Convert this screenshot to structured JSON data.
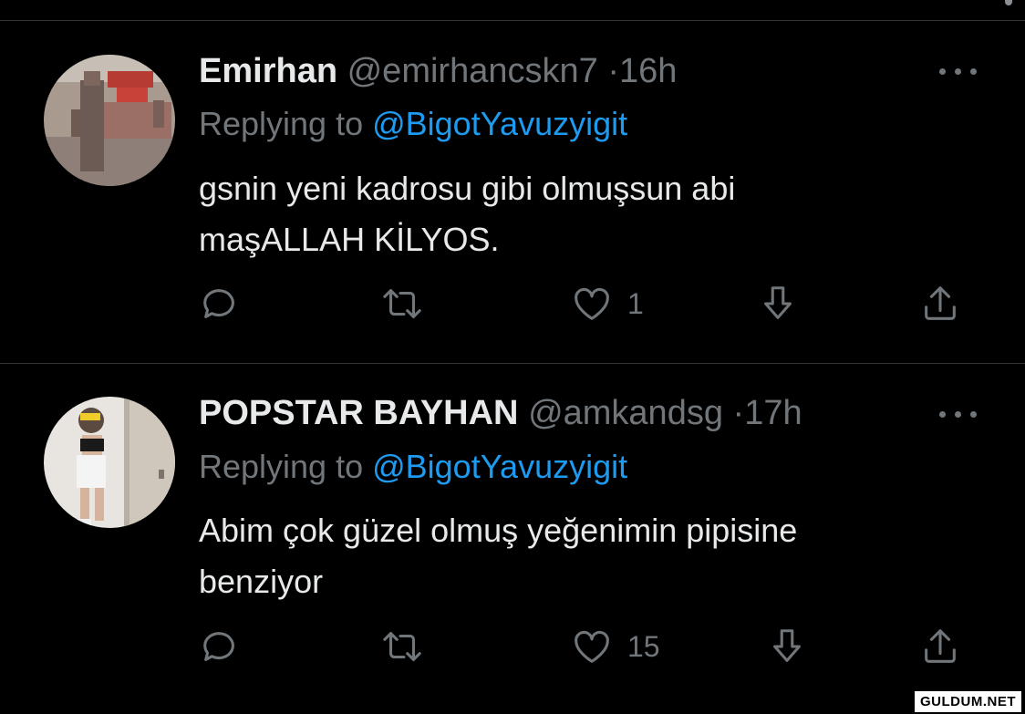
{
  "tweets": [
    {
      "name": "Emirhan",
      "handle": "@emirhancskn7",
      "separator": "·",
      "time": "16h",
      "replying_prefix": "Replying to ",
      "replying_to": "@BigotYavuzyigit",
      "text": "gsnin yeni kadrosu gibi olmuşsun abi\nmaşALLAH KİLYOS.",
      "likes": "1"
    },
    {
      "name": "POPSTAR BAYHAN",
      "handle": "@amkandsg",
      "separator": "·",
      "time": "17h",
      "replying_prefix": "Replying to ",
      "replying_to": "@BigotYavuzyigit",
      "text": "Abim çok güzel olmuş yeğenimin pipisine\nbenziyor",
      "likes": "15"
    }
  ],
  "watermark": "GULDUM.NET",
  "colors": {
    "background": "#000000",
    "text": "#e7e9ea",
    "secondary": "#71767b",
    "link": "#1d9bf0",
    "divider": "#2f3336"
  }
}
